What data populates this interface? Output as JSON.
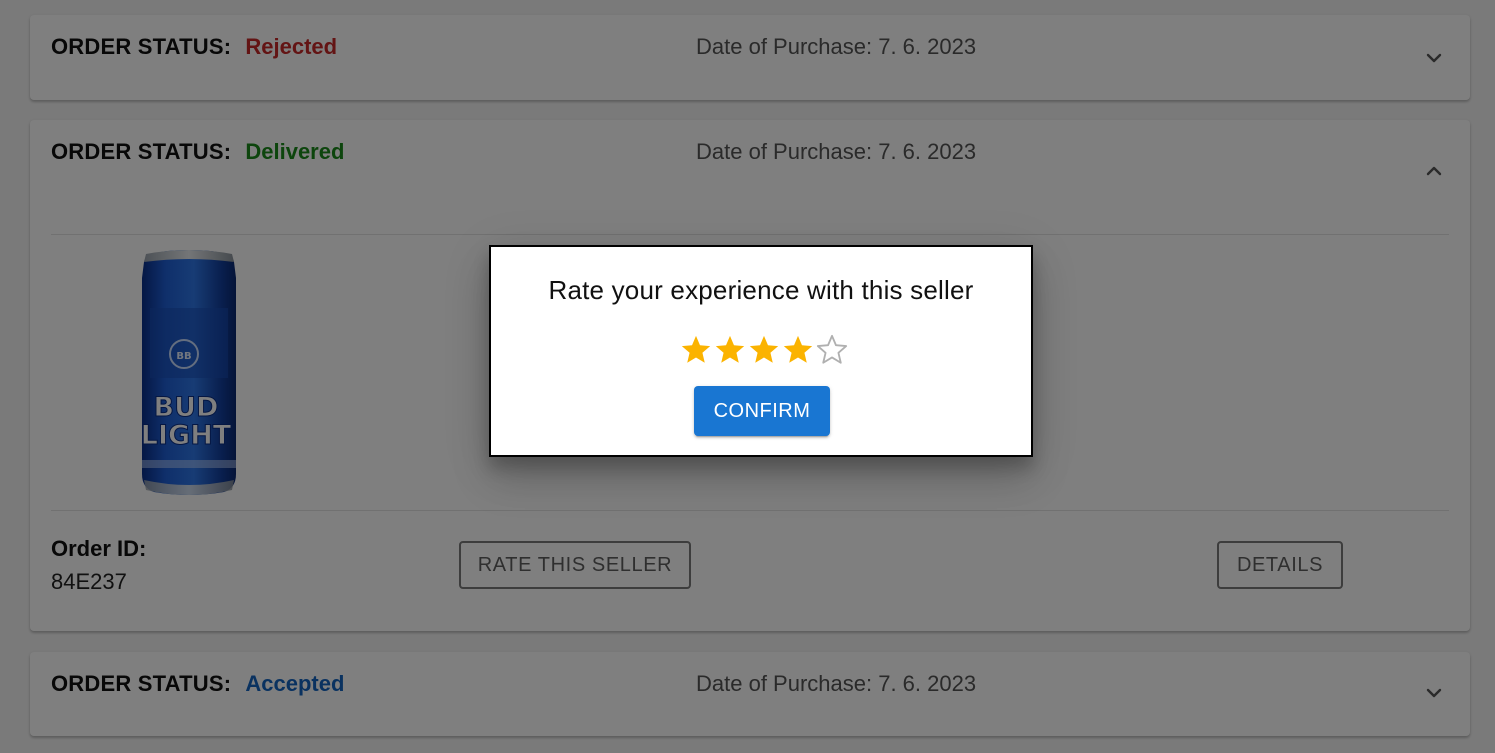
{
  "colors": {
    "rejected": "#c62828",
    "delivered": "#1b8a1b",
    "accepted": "#1565c0",
    "star_filled": "#fbb300",
    "star_empty": "#b0b0b0",
    "confirm_button": "#1976d2"
  },
  "orders": [
    {
      "status_label": "ORDER STATUS:",
      "status_value": "Rejected",
      "date": "Date of Purchase: 7. 6. 2023",
      "expanded": false,
      "chevron": "chevron-down-icon"
    },
    {
      "status_label": "ORDER STATUS:",
      "status_value": "Delivered",
      "date": "Date of Purchase: 7. 6. 2023",
      "expanded": true,
      "chevron": "chevron-up-icon",
      "product_image_label": "BUD LIGHT",
      "order_id_label": "Order ID:",
      "order_id": "84E237",
      "rate_button": "RATE THIS SELLER",
      "details_button": "DETAILS"
    },
    {
      "status_label": "ORDER STATUS:",
      "status_value": "Accepted",
      "date": "Date of Purchase: 7. 6. 2023",
      "expanded": false,
      "chevron": "chevron-down-icon"
    }
  ],
  "rating_dialog": {
    "title": "Rate your experience with this seller",
    "rating": 4,
    "max_rating": 5,
    "confirm_button": "CONFIRM"
  }
}
